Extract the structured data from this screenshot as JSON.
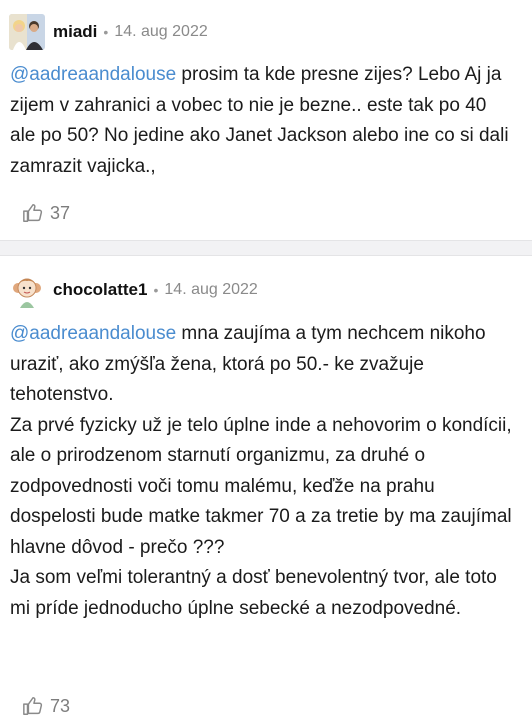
{
  "comments": [
    {
      "username": "miadi",
      "separator": "•",
      "date": "14. aug 2022",
      "mention": "@aadreaandalouse",
      "text": " prosim ta kde presne zijes? Lebo Aj ja zijem v zahranici a vobec to nie je bezne.. este tak po 40 ale po 50? No jedine ako Janet Jackson alebo ine co si dali zamrazit vajicka.,",
      "likes": "37",
      "avatar_icon": "couple-photo-avatar"
    },
    {
      "username": "chocolatte1",
      "separator": "•",
      "date": "14. aug 2022",
      "mention": "@aadreaandalouse",
      "text": " mna zaujíma a tym nechcem nikoho uraziť, ako zmýšľa žena, ktorá po 50.- ke zvažuje tehotenstvo.\nZa prvé fyzicky už je telo úplne inde a nehovorim o kondícii, ale o prirodzenom starnutí organizmu, za druhé o zodpovednosti voči tomu malému, keďže na prahu dospelosti bude matke takmer 70 a za tretie by ma zaujímal hlavne dôvod - prečo ???\nJa som veľmi tolerantný a dosť benevolentný tvor, ale toto mi príde jednoducho úplne sebecké a nezodpovedné.",
      "likes": "73",
      "avatar_icon": "cartoon-girl-avatar"
    }
  ],
  "colors": {
    "mention": "#4a8ccf",
    "meta": "#8a8a8a",
    "separator_bg": "#f2f2f4"
  }
}
